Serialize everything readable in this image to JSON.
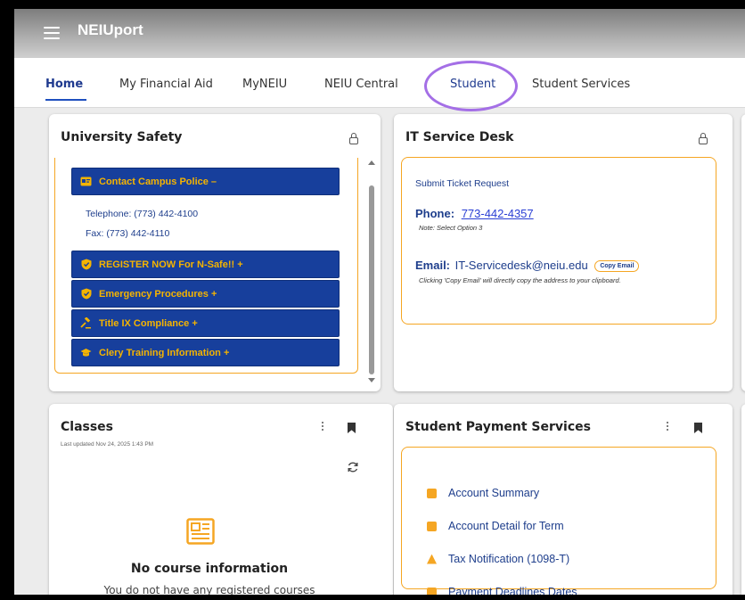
{
  "header": {
    "brand": "NEIUport"
  },
  "tabs": [
    {
      "label": "Home"
    },
    {
      "label": "My Financial Aid"
    },
    {
      "label": "MyNEIU"
    },
    {
      "label": "NEIU Central"
    },
    {
      "label": "Student"
    },
    {
      "label": "Student Services"
    }
  ],
  "safety": {
    "title": "University Safety",
    "contact_button": "Contact Campus Police –",
    "telephone": "Telephone: (773) 442-4100",
    "fax": "Fax: (773) 442-4110",
    "items": [
      "REGISTER NOW For N-Safe!! +",
      "Emergency Procedures +",
      "Title IX Compliance +",
      "Clery Training Information +"
    ]
  },
  "it_desk": {
    "title": "IT Service Desk",
    "submit_link": "Submit Ticket Request",
    "phone_label": "Phone:",
    "phone_number": "773-442-4357",
    "phone_note": "Note: Select Option 3",
    "email_label": "Email:",
    "email_address": "IT-Servicedesk@neiu.edu",
    "copy_button": "Copy Email",
    "email_note": "Clicking 'Copy Email' will directly copy the address to your clipboard."
  },
  "classes": {
    "title": "Classes",
    "updated": "Last updated Nov 24, 2025 1:43 PM",
    "empty_title": "No course information",
    "empty_text": "You do not have any registered courses"
  },
  "payment": {
    "title": "Student Payment Services",
    "items": [
      "Account Summary",
      "Account Detail for Term",
      "Tax Notification (1098-T)",
      "Payment Deadlines Dates"
    ]
  },
  "colors": {
    "accent_blue": "#173f9c",
    "accent_gold": "#f5a623",
    "highlight_purple": "#a46fe6"
  }
}
